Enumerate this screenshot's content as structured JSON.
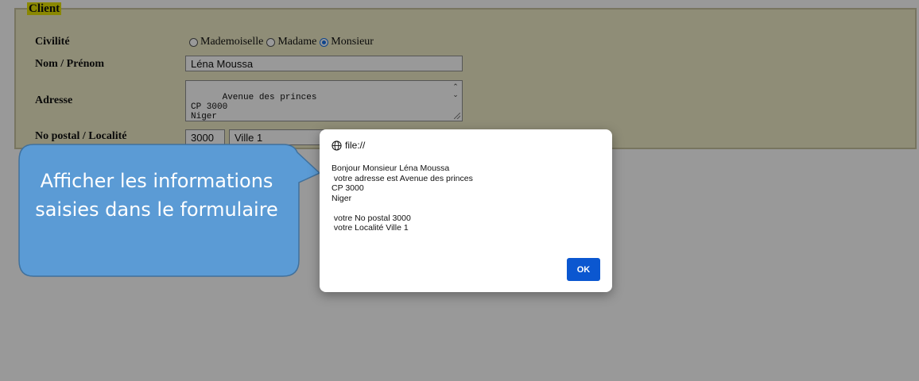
{
  "form": {
    "legend": "Client",
    "civilite_label": "Civilité",
    "civilite_options": [
      "Mademoiselle",
      "Madame",
      "Monsieur"
    ],
    "civilite_selected": "Monsieur",
    "nom_label": "Nom / Prénom",
    "nom_value": "Léna Moussa",
    "adresse_label": "Adresse",
    "adresse_value": "Avenue des princes\nCP 3000\nNiger",
    "postal_label": "No postal / Localité",
    "postal_value": "3000",
    "localite_value": "Ville 1"
  },
  "dialog": {
    "origin": "file://",
    "message": "Bonjour Monsieur Léna Moussa\n votre adresse est Avenue des princes\nCP 3000\nNiger\n\n votre No postal 3000\n votre Localité Ville 1",
    "ok_label": "OK"
  },
  "callout": {
    "text": "Afficher les informations saisies dans le formulaire",
    "fill_color": "#5b9bd5",
    "border_color": "#41719c"
  }
}
